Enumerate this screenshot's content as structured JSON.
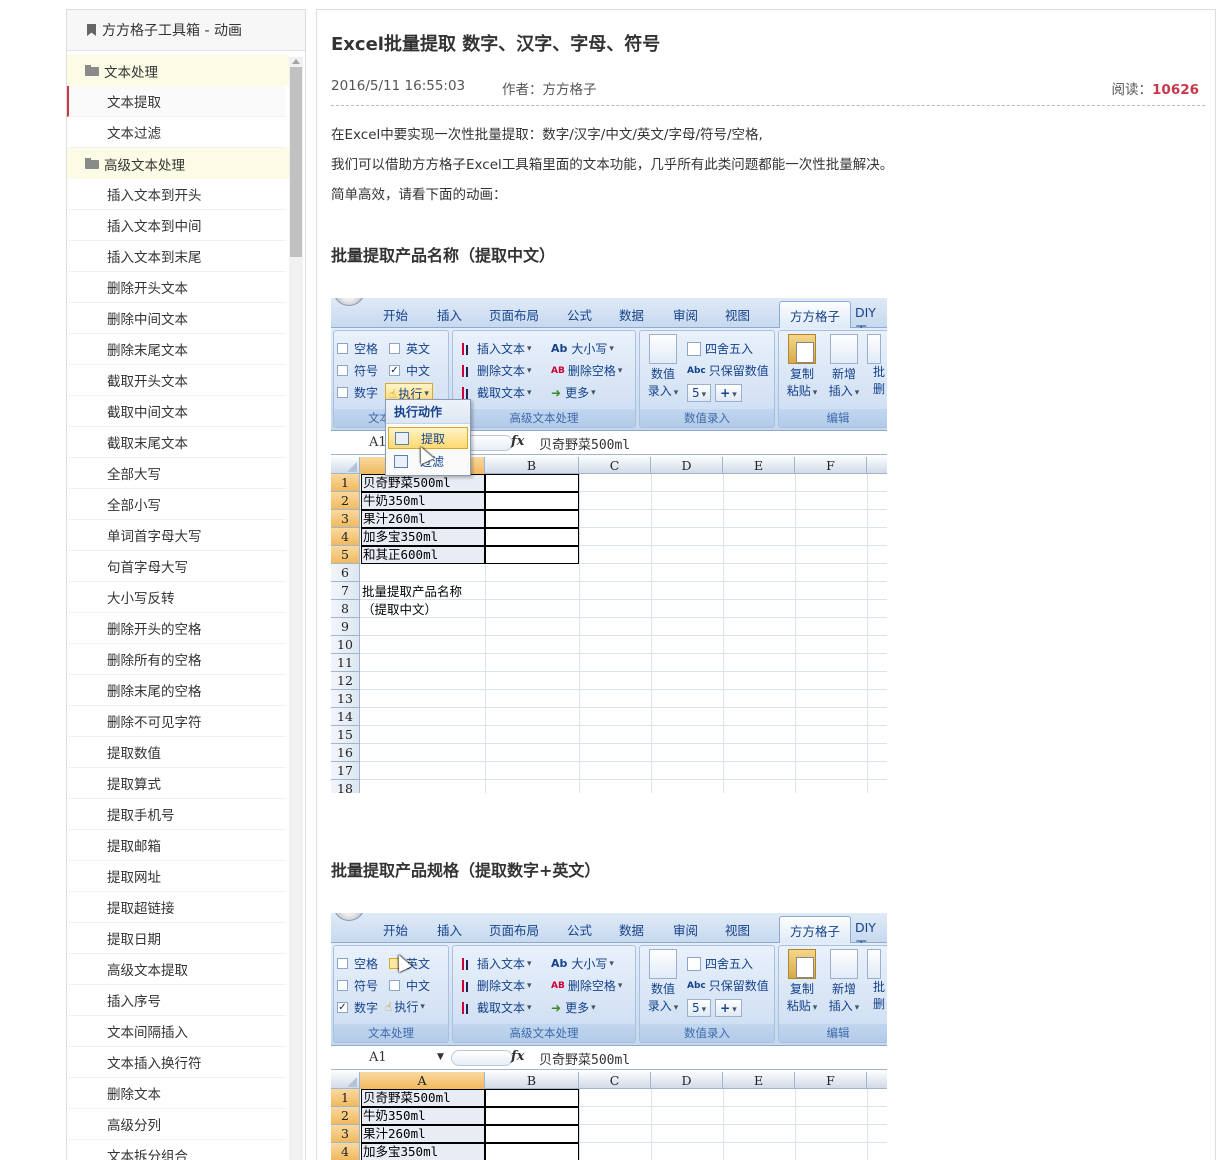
{
  "sidebar": {
    "header": "方方格子工具箱 - 动画",
    "categories": [
      {
        "label": "文本处理",
        "items": [
          "文本提取",
          "文本过滤"
        ]
      },
      {
        "label": "高级文本处理",
        "items": [
          "插入文本到开头",
          "插入文本到中间",
          "插入文本到末尾",
          "删除开头文本",
          "删除中间文本",
          "删除末尾文本",
          "截取开头文本",
          "截取中间文本",
          "截取末尾文本",
          "全部大写",
          "全部小写",
          "单词首字母大写",
          "句首字母大写",
          "大小写反转",
          "删除开头的空格",
          "删除所有的空格",
          "删除末尾的空格",
          "删除不可见字符",
          "提取数值",
          "提取算式",
          "提取手机号",
          "提取邮箱",
          "提取网址",
          "提取超链接",
          "提取日期",
          "高级文本提取",
          "插入序号",
          "文本间隔插入",
          "文本插入换行符",
          "删除文本",
          "高级分列",
          "文本拆分组合"
        ]
      }
    ],
    "active_item": "文本提取"
  },
  "article": {
    "title": "Excel批量提取 数字、汉字、字母、符号",
    "date": "2016/5/11 16:55:03",
    "author": "作者：方方格子",
    "reads_label": "阅读：",
    "reads_count": "10626",
    "paragraphs": [
      "在Excel中要实现一次性批量提取：数字/汉字/中文/英文/字母/符号/空格,",
      "我们可以借助方方格子Excel工具箱里面的文本功能，几乎所有此类问题都能一次性批量解决。",
      "简单高效，请看下面的动画："
    ],
    "section1_title": "批量提取产品名称（提取中文）",
    "section2_title": "批量提取产品规格（提取数字+英文）"
  },
  "excel": {
    "tabs": [
      "开始",
      "插入",
      "页面布局",
      "公式",
      "数据",
      "审阅",
      "视图",
      "方方格子",
      "DIY工"
    ],
    "selected_tab": "方方格子",
    "checkboxes": {
      "space": "空格",
      "english": "英文",
      "symbol": "符号",
      "chinese": "中文",
      "number": "数字"
    },
    "execute": "执行",
    "text_group": "文本处理",
    "adv_group": "高级文本处理",
    "adv_buttons": [
      "插入文本",
      "删除文本",
      "截取文本"
    ],
    "case_btn": "大小写",
    "case_prefix": "Ab",
    "del_space_btn": "删除空格",
    "del_space_prefix": "AB",
    "more_btn": "更多",
    "round_btn": "四舍五入",
    "keep_value_btn": "只保留数值",
    "keep_value_prefix": "Abc",
    "value_entry": [
      "数值",
      "录入"
    ],
    "value_group": "数值录入",
    "stepper_num": "5",
    "stepper_plus": "+",
    "copy_paste": [
      "复制",
      "粘贴"
    ],
    "new_insert": [
      "新增",
      "插入"
    ],
    "batch_delete": [
      "批",
      "删"
    ],
    "edit_group": "编辑",
    "namebox": "A1",
    "fx": "fx",
    "formula_value": "贝奇野菜500ml",
    "columns": [
      "A",
      "B",
      "C",
      "D",
      "E",
      "F"
    ],
    "rows": [
      "1",
      "2",
      "3",
      "4",
      "5",
      "6",
      "7",
      "8",
      "9",
      "10",
      "11",
      "12",
      "13",
      "14",
      "15",
      "16",
      "17",
      "18"
    ],
    "cells": [
      "贝奇野菜500ml",
      "牛奶350ml",
      "果汁260ml",
      "加多宝350ml",
      "和其正600ml"
    ],
    "note_lines": [
      "批量提取产品名称",
      "（提取中文）"
    ],
    "popup_title": "执行动作",
    "popup_items": [
      "提取",
      "过滤"
    ]
  }
}
